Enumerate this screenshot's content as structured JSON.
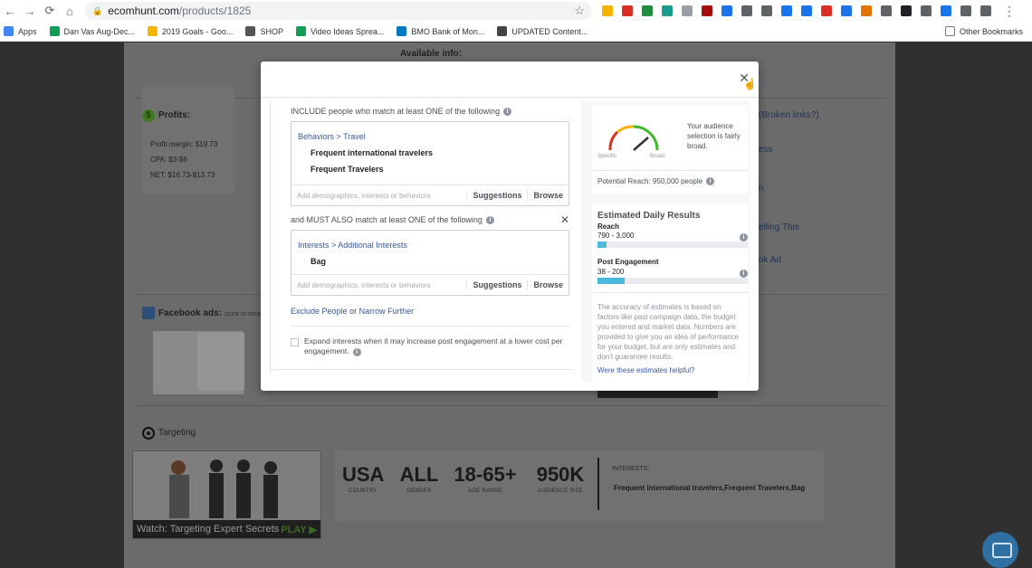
{
  "browser": {
    "url_host": "ecomhunt.com",
    "url_path": "/products/1825",
    "bookmarks": [
      {
        "label": "Apps",
        "color": "#4285f4"
      },
      {
        "label": "Dan Vas Aug-Dec...",
        "color": "#0f9d58"
      },
      {
        "label": "2019 Goals - Goo...",
        "color": "#f4b400"
      },
      {
        "label": "SHOP",
        "color": "#555555"
      },
      {
        "label": "Video Ideas Sprea...",
        "color": "#0f9d58"
      },
      {
        "label": "BMO Bank of Mon...",
        "color": "#0079c1"
      },
      {
        "label": "UPDATED Content...",
        "color": "#444444"
      }
    ],
    "other_bookmarks": "Other Bookmarks",
    "extension_colors": [
      "#f4b400",
      "#d93025",
      "#1e8e3e",
      "#1a9c8a",
      "#9aa0a6",
      "#a50e0e",
      "#1a73e8",
      "#5f6368",
      "#5f6368",
      "#1a73e8",
      "#1a73e8",
      "#d93025",
      "#1a73e8",
      "#e37400",
      "#5f6368",
      "#202124",
      "#5f6368",
      "#1a73e8",
      "#5f6368",
      "#5f6368"
    ]
  },
  "page": {
    "available_info": "Available info:",
    "profits_title": "Profits:",
    "profit_margin": "Profit margin: $19.73",
    "cpa": "CPA: $3-$6",
    "net": "NET: $16.73-$13.73",
    "broken_links": "(Broken links?)",
    "side_link_1": "ess",
    "side_link_2": "n",
    "side_link_3": "elling This",
    "side_link_4": "ok Ad",
    "fb_ads_title": "Facebook ads:",
    "fb_ads_hint": "(CLICK TO ZOOM)",
    "targeting_title": "Targeting",
    "video_title": "Watch: Targeting Expert Secrets",
    "video_play": "PLAY",
    "stats": [
      {
        "value": "USA",
        "label": "COUNTRY"
      },
      {
        "value": "ALL",
        "label": "GENDER"
      },
      {
        "value": "18-65+",
        "label": "AGE RANGE"
      },
      {
        "value": "950K",
        "label": "AUDIENCE SIZE"
      }
    ],
    "interests_label": "INTERESTS:",
    "interests_value": "Frequent international travelers,Frequent Travelers,Bag"
  },
  "modal": {
    "close": "✕",
    "include_title": "INCLUDE people who match at least ONE of the following",
    "include_crumb": "Behaviors > Travel",
    "include_tags": [
      "Frequent international travelers",
      "Frequent Travelers"
    ],
    "input_placeholder": "Add demographics, interests or behaviors",
    "suggestions": "Suggestions",
    "browse": "Browse",
    "must_title": "and MUST ALSO match at least ONE of the following",
    "must_crumb": "Interests > Additional Interests",
    "must_tags": [
      "Bag"
    ],
    "exclude_link": "Exclude People",
    "or_text": "or",
    "narrow_link": "Narrow Further",
    "expand_text": "Expand interests when it may increase post engagement at a lower cost per engagement.",
    "gauge_text": "Your audience selection is fairly broad.",
    "gauge_specific": "Specific",
    "gauge_broad": "Broad",
    "potential_reach": "Potential Reach: 950,000 people",
    "estimated_title": "Estimated Daily Results",
    "reach_label": "Reach",
    "reach_range": "790 - 3,000",
    "reach_fill": 0.06,
    "engagement_label": "Post Engagement",
    "engagement_range": "38 - 200",
    "engagement_fill": 0.18,
    "accuracy_text": "The accuracy of estimates is based on factors like past campaign data, the budget you entered and market data. Numbers are provided to give you an idea of performance for your budget, but are only estimates and don't guarantee results.",
    "helpful_link": "Were these estimates helpful?"
  }
}
